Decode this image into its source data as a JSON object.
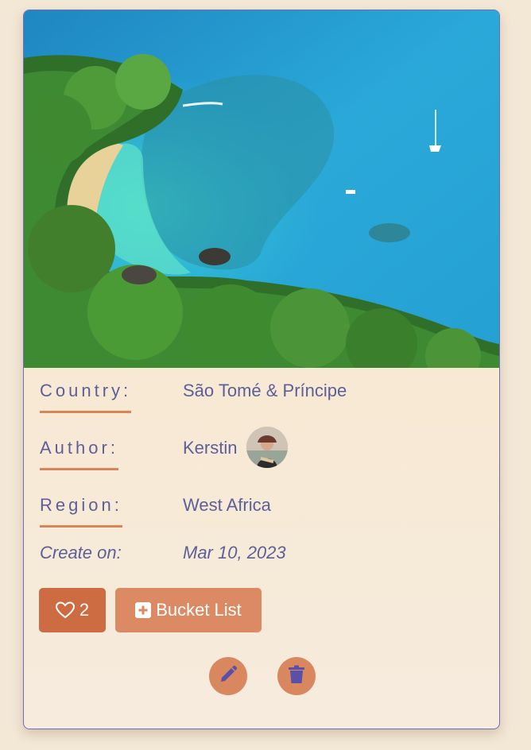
{
  "card": {
    "image_alt": "Tropical beach with turquoise water and palm forest",
    "fields": {
      "country_label": "Country:",
      "country_value": "São Tomé & Príncipe",
      "author_label": "Author:",
      "author_value": "Kerstin",
      "region_label": "Region:",
      "region_value": "West Africa",
      "created_label": "Create on:",
      "created_value": "Mar 10, 2023"
    },
    "actions": {
      "like_count": "2",
      "like_icon": "heart-outline-icon",
      "bucket_label": "Bucket List",
      "bucket_icon": "plus-square-icon",
      "edit_icon": "pencil-icon",
      "delete_icon": "trash-icon"
    }
  },
  "colors": {
    "label_text": "#5d5f99",
    "underline": "#d9855a",
    "button": "#d4754a",
    "card_border": "#6b6fb3"
  }
}
